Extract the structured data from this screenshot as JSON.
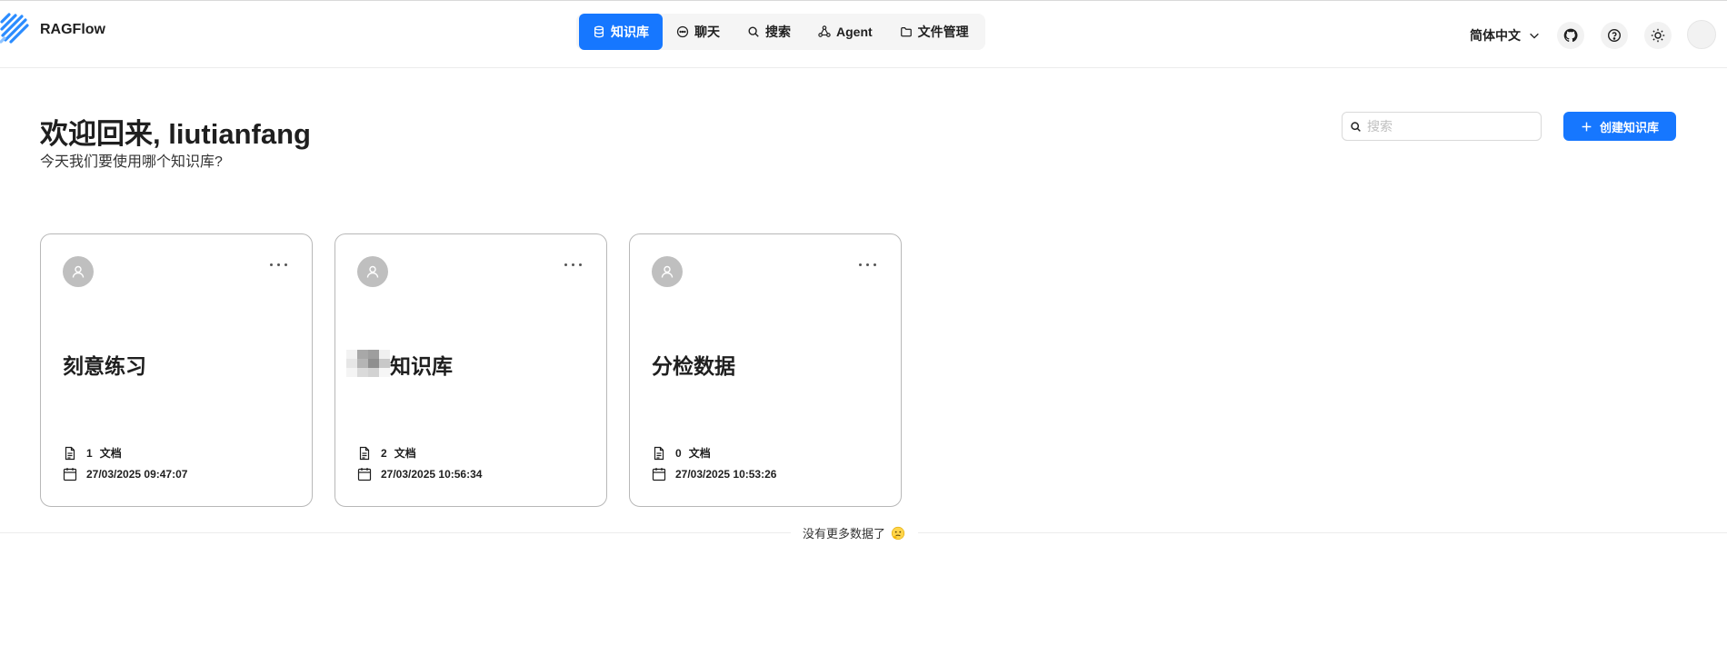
{
  "app": {
    "title": "RAGFlow"
  },
  "nav": [
    {
      "label": "知识库",
      "icon": "database-icon",
      "active": true
    },
    {
      "label": "聊天",
      "icon": "chat-icon",
      "active": false
    },
    {
      "label": "搜索",
      "icon": "search-icon",
      "active": false
    },
    {
      "label": "Agent",
      "icon": "agent-graph-icon",
      "active": false
    },
    {
      "label": "文件管理",
      "icon": "folder-icon",
      "active": false
    }
  ],
  "header": {
    "language": "简体中文",
    "icons": [
      "github-icon",
      "help-icon",
      "theme-sun-icon"
    ]
  },
  "welcome": {
    "title": "欢迎回来, liutianfang",
    "subtitle": "今天我们要使用哪个知识库?"
  },
  "search": {
    "placeholder": "搜索",
    "value": ""
  },
  "create_button": {
    "label": "创建知识库"
  },
  "cards": [
    {
      "title": "刻意练习",
      "doc_count": "1",
      "doc_label": "文档",
      "date": "27/03/2025 09:47:07"
    },
    {
      "title": "知识库",
      "doc_count": "2",
      "doc_label": "文档",
      "date": "27/03/2025 10:56:34",
      "redacted_prefix": true
    },
    {
      "title": "分检数据",
      "doc_count": "0",
      "doc_label": "文档",
      "date": "27/03/2025 10:53:26"
    }
  ],
  "footer": {
    "no_more": "没有更多数据了"
  },
  "colors": {
    "accent": "#1677ff",
    "card_border": "#b8b8b8",
    "avatar_bg": "#bfbfbf"
  }
}
